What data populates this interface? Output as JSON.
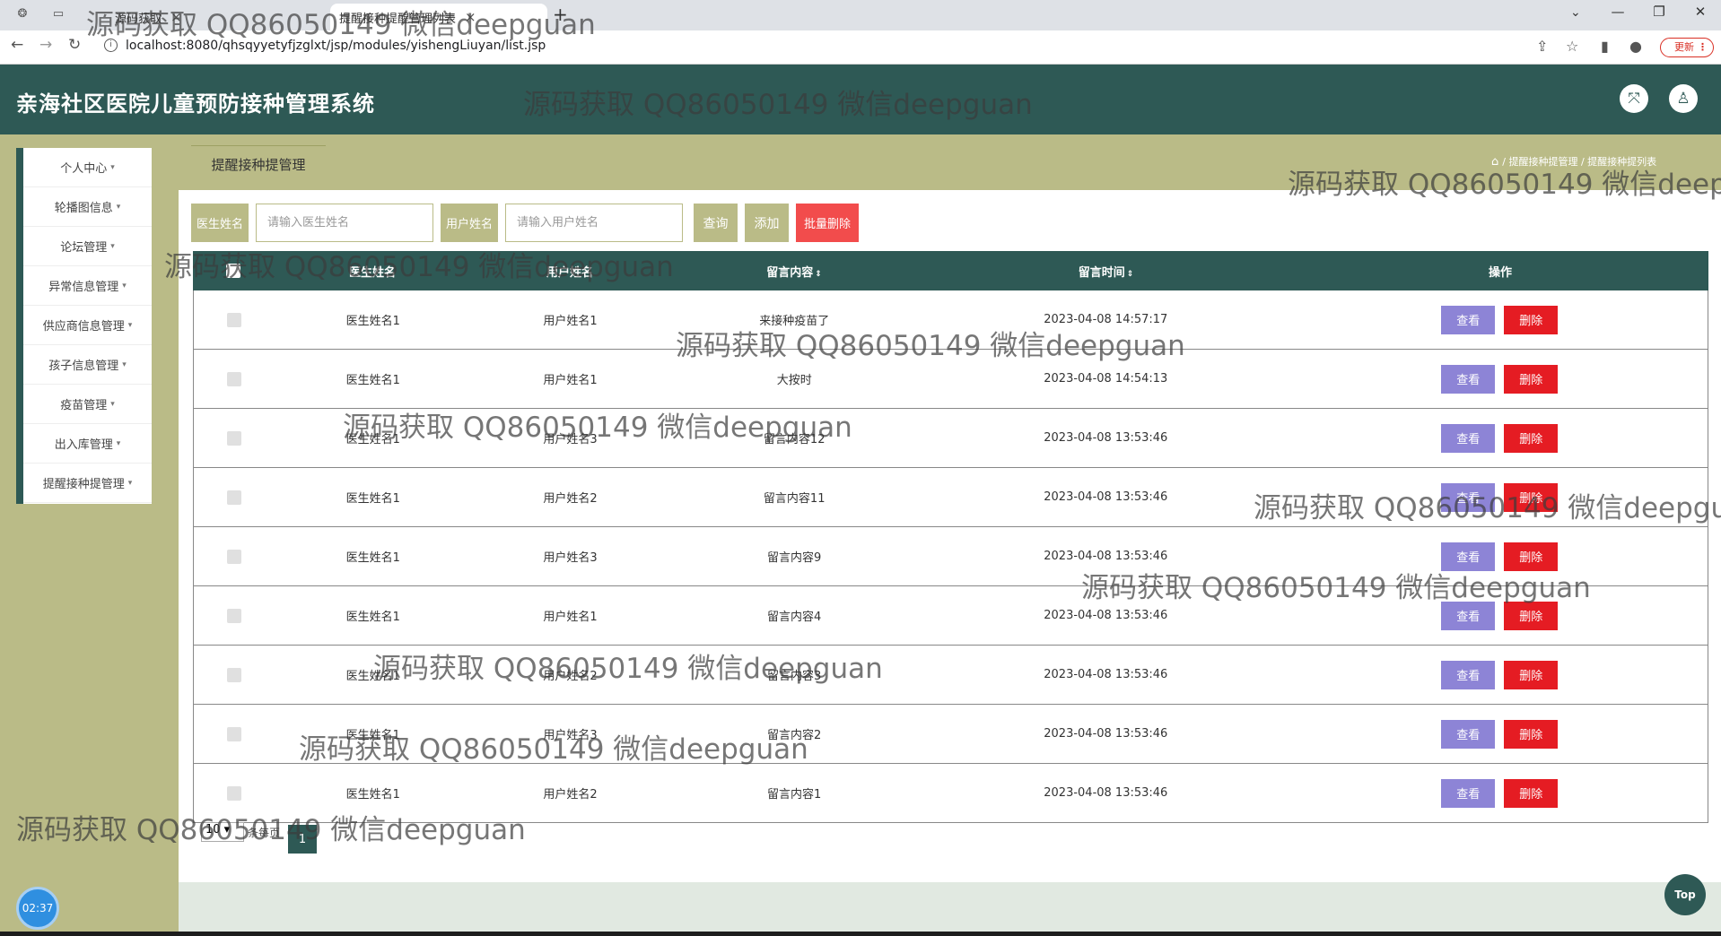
{
  "browser": {
    "tab1_title": "源码获取",
    "tab2_title": "提醒接种提醒管理列表",
    "url": "localhost:8080/qhsqyyetyfjzglxt/jsp/modules/yishengLiuyan/list.jsp",
    "update_label": "更新"
  },
  "header": {
    "title": "亲海社区医院儿童预防接种管理系统"
  },
  "sidebar": {
    "items": [
      {
        "label": "个人中心"
      },
      {
        "label": "轮播图信息"
      },
      {
        "label": "论坛管理"
      },
      {
        "label": "异常信息管理"
      },
      {
        "label": "供应商信息管理"
      },
      {
        "label": "孩子信息管理"
      },
      {
        "label": "疫苗管理"
      },
      {
        "label": "出入库管理"
      },
      {
        "label": "提醒接种提管理"
      }
    ]
  },
  "page": {
    "tab_title": "提醒接种提管理",
    "breadcrumb_1": "提醒接种提管理",
    "breadcrumb_2": "提醒接种提列表"
  },
  "search": {
    "doctor_label": "医生姓名",
    "doctor_placeholder": "请输入医生姓名",
    "user_label": "用户姓名",
    "user_placeholder": "请输入用户姓名",
    "query_label": "查询",
    "add_label": "添加",
    "batch_delete_label": "批量删除"
  },
  "table": {
    "headers": {
      "doctor": "医生姓名",
      "user": "用户姓名",
      "content": "留言内容",
      "time": "留言时间",
      "actions": "操作"
    },
    "view_label": "查看",
    "delete_label": "删除",
    "rows": [
      {
        "doctor": "医生姓名1",
        "user": "用户姓名1",
        "content": "来接种疫苗了",
        "time": "2023-04-08 14:57:17"
      },
      {
        "doctor": "医生姓名1",
        "user": "用户姓名1",
        "content": "大按时",
        "time": "2023-04-08 14:54:13"
      },
      {
        "doctor": "医生姓名1",
        "user": "用户姓名3",
        "content": "留言内容12",
        "time": "2023-04-08 13:53:46"
      },
      {
        "doctor": "医生姓名1",
        "user": "用户姓名2",
        "content": "留言内容11",
        "time": "2023-04-08 13:53:46"
      },
      {
        "doctor": "医生姓名1",
        "user": "用户姓名3",
        "content": "留言内容9",
        "time": "2023-04-08 13:53:46"
      },
      {
        "doctor": "医生姓名1",
        "user": "用户姓名1",
        "content": "留言内容4",
        "time": "2023-04-08 13:53:46"
      },
      {
        "doctor": "医生姓名1",
        "user": "用户姓名2",
        "content": "留言内容3",
        "time": "2023-04-08 13:53:46"
      },
      {
        "doctor": "医生姓名1",
        "user": "用户姓名3",
        "content": "留言内容2",
        "time": "2023-04-08 13:53:46"
      },
      {
        "doctor": "医生姓名1",
        "user": "用户姓名2",
        "content": "留言内容1",
        "time": "2023-04-08 13:53:46"
      }
    ]
  },
  "pagination": {
    "page_size": "10",
    "page_size_label": "条每页",
    "current_page": "1"
  },
  "widgets": {
    "clock": "02:37",
    "top_label": "Top"
  },
  "watermark": "源码获取 QQ86050149 微信deepguan"
}
